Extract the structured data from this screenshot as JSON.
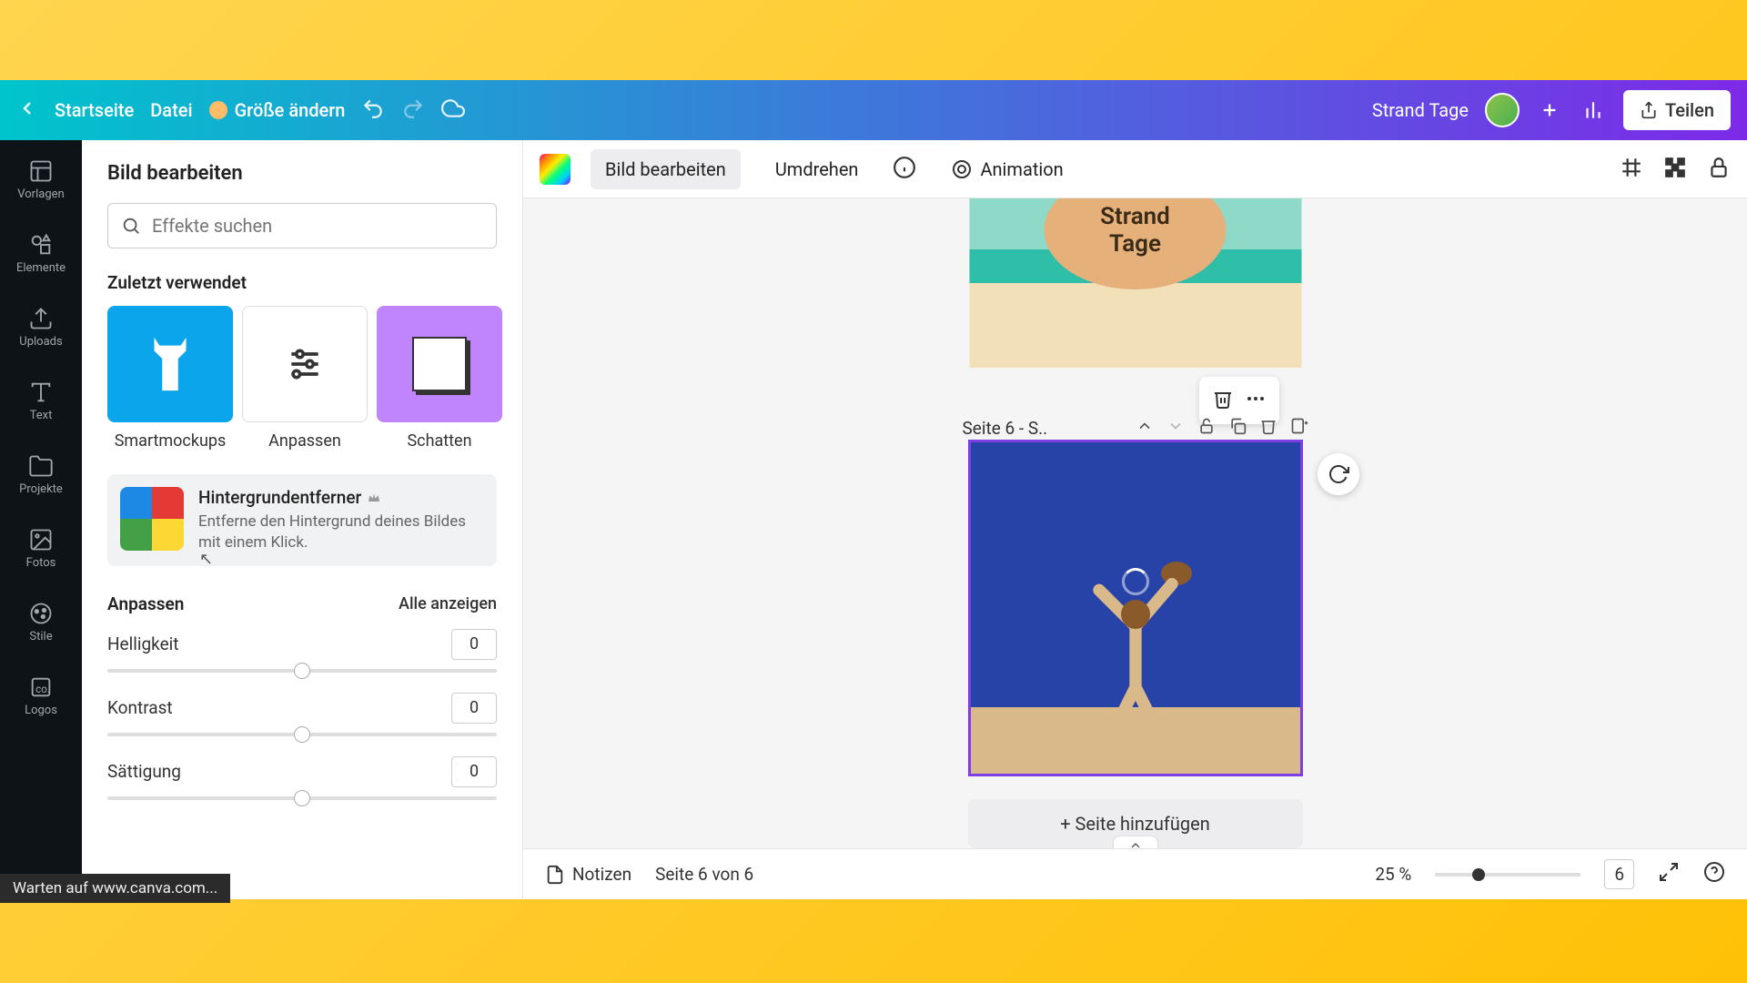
{
  "topbar": {
    "home": "Startseite",
    "file": "Datei",
    "resize": "Größe ändern",
    "doc_title": "Strand Tage",
    "share": "Teilen"
  },
  "nav": {
    "templates": "Vorlagen",
    "elements": "Elemente",
    "uploads": "Uploads",
    "text": "Text",
    "projects": "Projekte",
    "photos": "Fotos",
    "styles": "Stile",
    "logos": "Logos"
  },
  "panel": {
    "title": "Bild bearbeiten",
    "search_placeholder": "Effekte suchen",
    "recent_label": "Zuletzt verwendet",
    "recent": {
      "smartmockups": "Smartmockups",
      "adjust": "Anpassen",
      "shadow": "Schatten"
    },
    "bgremover": {
      "title": "Hintergrundentferner",
      "desc": "Entferne den Hintergrund deines Bildes mit einem Klick."
    },
    "adjust": {
      "header": "Anpassen",
      "show_all": "Alle anzeigen",
      "brightness": {
        "label": "Helligkeit",
        "value": "0"
      },
      "contrast": {
        "label": "Kontrast",
        "value": "0"
      },
      "saturation": {
        "label": "Sättigung",
        "value": "0"
      }
    }
  },
  "context": {
    "edit": "Bild bearbeiten",
    "flip": "Umdrehen",
    "animation": "Animation"
  },
  "canvas": {
    "page5_text_top": "Strand",
    "page5_text_bottom": "Tage",
    "page6_label": "Seite 6 - S..",
    "add_page": "+ Seite hinzufügen"
  },
  "bottom": {
    "notes": "Notizen",
    "page_counter": "Seite 6 von 6",
    "zoom": "25 %",
    "grid_count": "6"
  },
  "status": "Warten auf www.canva.com..."
}
